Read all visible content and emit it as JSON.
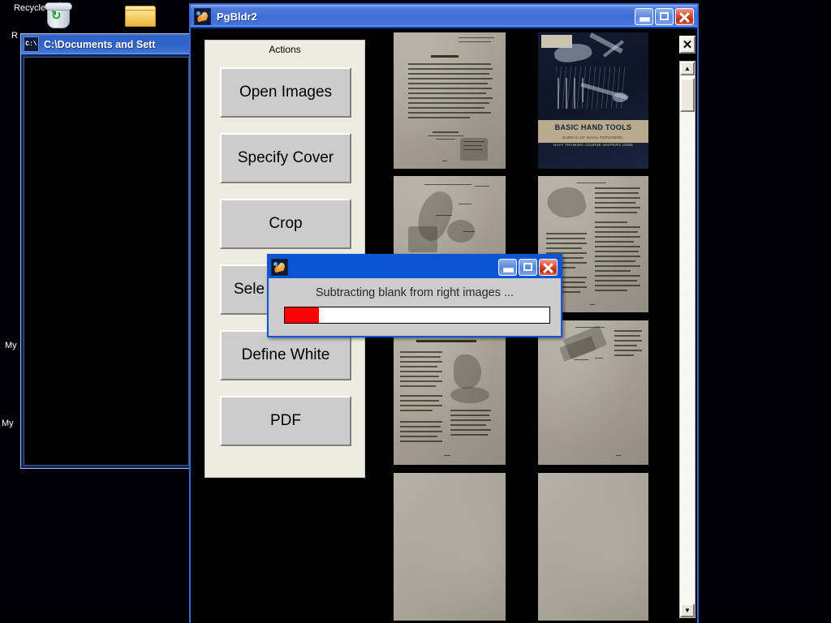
{
  "desktop": {
    "icons": [
      {
        "name": "recycle-bin",
        "label": "Recycle Bin",
        "icon": "recycle-bin-icon"
      },
      {
        "name": "folder",
        "label": "",
        "icon": "folder-icon"
      },
      {
        "name": "my-documents",
        "label": "My ",
        "icon": "my-documents-icon"
      },
      {
        "name": "my-computer",
        "label": "My ",
        "icon": "my-computer-icon"
      }
    ],
    "background_color": "#000006"
  },
  "cmd_window": {
    "title": "C:\\Documents and Sett",
    "icon": "command-prompt-icon",
    "icon_glyph": "C:\\",
    "client_background": "#000000"
  },
  "main_window": {
    "title": "PgBldr2",
    "icon": "matlab-icon",
    "titlebar_color": "#3f6ed9",
    "client_background": "#000000",
    "buttons": {
      "minimize": "minimize-button",
      "maximize": "maximize-button",
      "close": "close-button"
    }
  },
  "actions_panel": {
    "title": "Actions",
    "background_color": "#ecece0",
    "buttons": [
      {
        "id": "open-images",
        "label": "Open Images"
      },
      {
        "id": "specify-cover",
        "label": "Specify Cover"
      },
      {
        "id": "crop",
        "label": "Crop"
      },
      {
        "id": "select-blank",
        "label": "Sele"
      },
      {
        "id": "define-white",
        "label": "Define White"
      },
      {
        "id": "pdf",
        "label": "PDF"
      }
    ]
  },
  "thumbnails": {
    "columns": 2,
    "items": [
      {
        "id": "thumb-1",
        "kind": "text-page",
        "caption": ""
      },
      {
        "id": "thumb-2",
        "kind": "book-cover",
        "caption": "BASIC HAND TOOLS",
        "subtitle_1": "BUREAU OF NAVAL PERSONNEL",
        "subtitle_2": "NAVY TRAINING COURSE      NAVPERS 10085"
      },
      {
        "id": "thumb-3",
        "kind": "illustration-page",
        "caption": ""
      },
      {
        "id": "thumb-4",
        "kind": "two-column-page",
        "caption": ""
      },
      {
        "id": "thumb-5",
        "kind": "two-column-page",
        "caption": ""
      },
      {
        "id": "thumb-6",
        "kind": "illustration-page",
        "caption": ""
      },
      {
        "id": "thumb-7",
        "kind": "blank-page",
        "caption": ""
      },
      {
        "id": "thumb-8",
        "kind": "blank-page",
        "caption": ""
      }
    ]
  },
  "scrollbar": {
    "close_label": "✕",
    "up_label": "▲",
    "down_label": "▼"
  },
  "progress_dialog": {
    "title": "",
    "icon": "matlab-icon",
    "message": "Subtracting blank from right images ...",
    "progress_percent": 13,
    "bar_color": "#ff0000",
    "buttons": {
      "minimize": "minimize-button",
      "maximize": "maximize-button",
      "close": "close-button"
    }
  }
}
